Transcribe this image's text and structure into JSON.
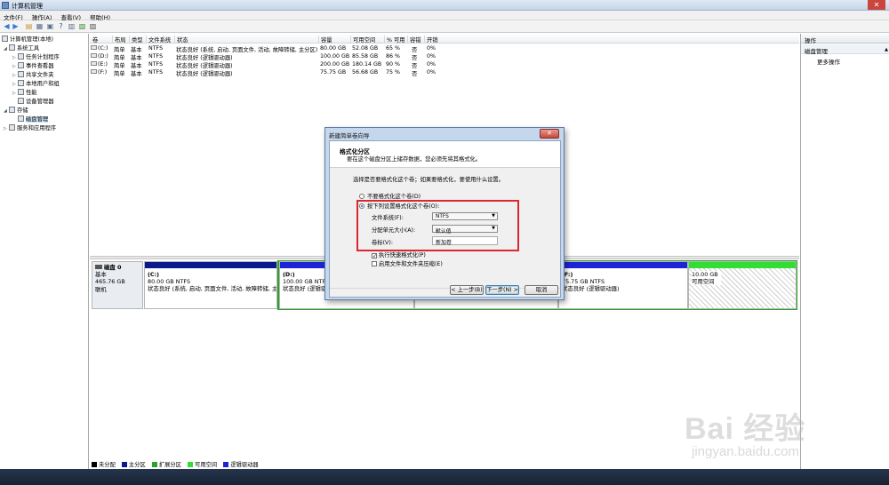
{
  "window": {
    "title": "计算机管理"
  },
  "menu": [
    "文件(F)",
    "操作(A)",
    "查看(V)",
    "帮助(H)"
  ],
  "tree": [
    {
      "label": "计算机管理(本地)",
      "indent": 0,
      "tri": ""
    },
    {
      "label": "系统工具",
      "indent": 1,
      "tri": "◢"
    },
    {
      "label": "任务计划程序",
      "indent": 2,
      "tri": "▷"
    },
    {
      "label": "事件查看器",
      "indent": 2,
      "tri": "▷"
    },
    {
      "label": "共享文件夹",
      "indent": 2,
      "tri": "▷"
    },
    {
      "label": "本地用户和组",
      "indent": 2,
      "tri": "▷"
    },
    {
      "label": "性能",
      "indent": 2,
      "tri": "▷"
    },
    {
      "label": "设备管理器",
      "indent": 2,
      "tri": ""
    },
    {
      "label": "存储",
      "indent": 1,
      "tri": "◢"
    },
    {
      "label": "磁盘管理",
      "indent": 2,
      "tri": "",
      "selected": true
    },
    {
      "label": "服务和应用程序",
      "indent": 1,
      "tri": "▷"
    }
  ],
  "volume_table": {
    "headers": [
      "卷",
      "布局",
      "类型",
      "文件系统",
      "状态",
      "容量",
      "可用空间",
      "% 可用",
      "容错",
      "开销"
    ],
    "rows": [
      [
        "(C:)",
        "简单",
        "基本",
        "NTFS",
        "状态良好 (系统, 启动, 页面文件, 活动, 故障转储, 主分区)",
        "80.00 GB",
        "52.08 GB",
        "65 %",
        "否",
        "0%"
      ],
      [
        "(D:)",
        "简单",
        "基本",
        "NTFS",
        "状态良好 (逻辑驱动器)",
        "100.00 GB",
        "85.58 GB",
        "86 %",
        "否",
        "0%"
      ],
      [
        "(E:)",
        "简单",
        "基本",
        "NTFS",
        "状态良好 (逻辑驱动器)",
        "200.00 GB",
        "180.14 GB",
        "90 %",
        "否",
        "0%"
      ],
      [
        "(F:)",
        "简单",
        "基本",
        "NTFS",
        "状态良好 (逻辑驱动器)",
        "75.75 GB",
        "56.68 GB",
        "75 %",
        "否",
        "0%"
      ]
    ]
  },
  "disk": {
    "name": "磁盘 0",
    "type": "基本",
    "size": "465.76 GB",
    "status": "联机",
    "partitions": [
      {
        "name": "(C:)",
        "size": "80.00 GB NTFS",
        "status": "状态良好 (系统, 启动, 页面文件, 活动, 故障转储, 主",
        "color": "#0a1a8c"
      },
      {
        "name": "(D:)",
        "size": "100.00 GB NTFS",
        "status": "状态良好 (逻辑驱动器)",
        "color": "#1f22d6"
      },
      {
        "name": "(F:)",
        "size": "75.75 GB NTFS",
        "status": "状态良好 (逻辑驱动器)",
        "color": "#1f22d6"
      },
      {
        "name": "",
        "size": "10.00 GB",
        "status": "可用空间",
        "color": "#33dd33"
      }
    ]
  },
  "legend": [
    {
      "label": "未分配",
      "color": "#000000"
    },
    {
      "label": "主分区",
      "color": "#0a1a8c"
    },
    {
      "label": "扩展分区",
      "color": "#2aa32a"
    },
    {
      "label": "可用空间",
      "color": "#33dd33"
    },
    {
      "label": "逻辑驱动器",
      "color": "#1f22d6"
    }
  ],
  "actions": {
    "header": "操作",
    "section": "磁盘管理",
    "more": "更多操作"
  },
  "dialog": {
    "title": "新建简单卷向导",
    "heading": "格式化分区",
    "subheading": "要在这个磁盘分区上储存数据，您必须先将其格式化。",
    "prompt": "选择是否要格式化这个卷；如果要格式化，要使用什么设置。",
    "option_no_format": "不要格式化这个卷(D)",
    "option_format": "按下列设置格式化这个卷(O):",
    "file_system_label": "文件系统(F):",
    "file_system_value": "NTFS",
    "alloc_label": "分配单元大小(A):",
    "alloc_value": "默认值",
    "volume_label_label": "卷标(V):",
    "volume_label_value": "新加卷",
    "quick_format": "执行快速格式化(P)",
    "compression": "启用文件和文件夹压缩(E)",
    "back_button": "< 上一步(B)",
    "next_button": "下一步(N) >",
    "cancel_button": "取消"
  },
  "watermark": {
    "brand": "Bai  经验",
    "url": "jingyan.baidu.com"
  }
}
